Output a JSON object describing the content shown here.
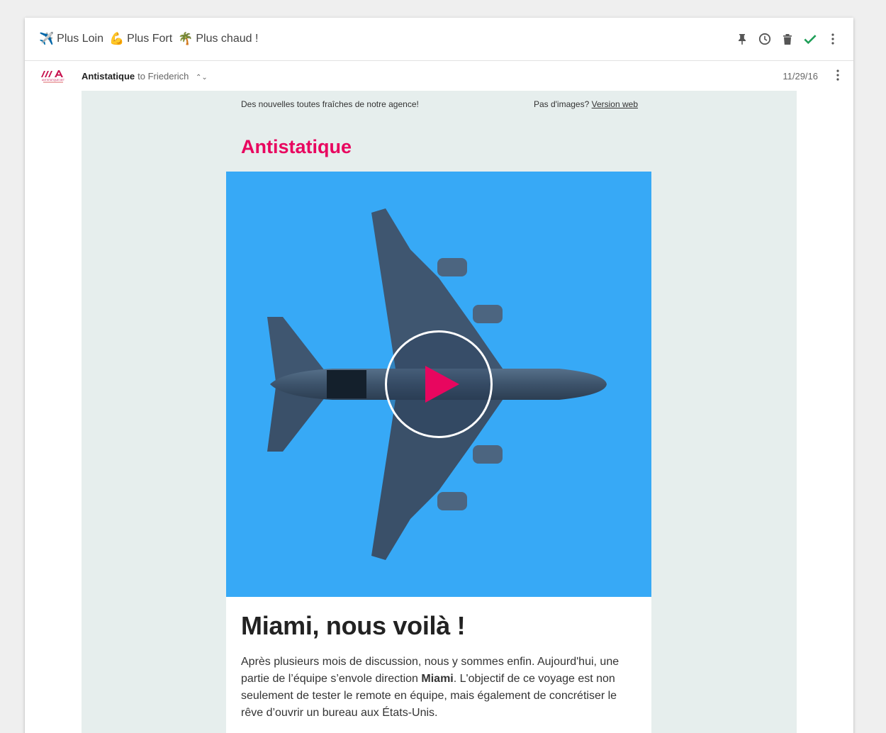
{
  "email": {
    "subject_parts": [
      {
        "emoji": "✈️",
        "text": "Plus Loin"
      },
      {
        "emoji": "💪",
        "text": "Plus Fort"
      },
      {
        "emoji": "🌴",
        "text": "Plus chaud !"
      }
    ],
    "actions": [
      "pin-icon",
      "clock-icon",
      "trash-icon",
      "check-icon",
      "more-icon"
    ],
    "sender": "Antistatique",
    "to_prefix": "to",
    "recipient": "Friederich",
    "date": "11/29/16",
    "avatar_text": "ANTISTATIQUE.NET"
  },
  "newsletter": {
    "preheader": "Des nouvelles toutes fraîches de notre agence!",
    "no_images": "Pas d'images?",
    "web_version": "Version web",
    "brand": "Antistatique",
    "headline": "Miami, nous voilà !",
    "body_before": "Après plusieurs mois de discussion, nous y sommes enfin. Aujourd'hui, une partie de l’équipe s’envole direction ",
    "body_bold": "Miami",
    "body_after": ". L'objectif de ce voyage est non seulement de tester le remote en équipe, mais également de concrétiser le rêve d’ouvrir un bureau aux États-Unis."
  },
  "colors": {
    "accent": "#e8065f",
    "hero_bg": "#37a9f6",
    "done": "#1e9e57"
  }
}
